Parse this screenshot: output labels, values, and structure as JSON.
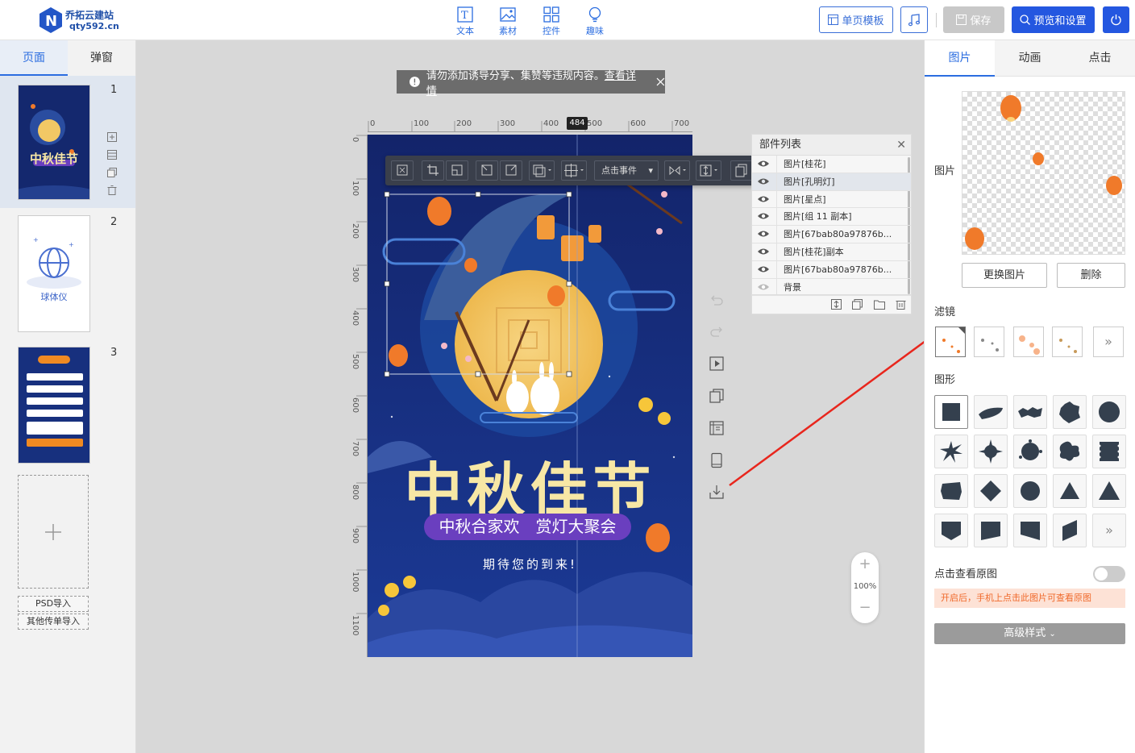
{
  "brand": {
    "name": "乔拓云建站",
    "domain": "qty592.cn"
  },
  "toolbar": {
    "tools": [
      {
        "label": "文本",
        "icon": "text-icon"
      },
      {
        "label": "素材",
        "icon": "image-icon"
      },
      {
        "label": "控件",
        "icon": "widgets-icon"
      },
      {
        "label": "趣味",
        "icon": "bulb-icon"
      }
    ],
    "template_button": "单页模板",
    "music_icon": "music-note-icon",
    "save_button": "保存",
    "preview_button": "预览和设置",
    "power_icon": "power-icon"
  },
  "left_panel": {
    "tabs": [
      "页面",
      "弹窗"
    ],
    "pages": [
      {
        "number": "1",
        "thumb_title": "中秋佳节"
      },
      {
        "number": "2",
        "thumb_title": "球体仪"
      },
      {
        "number": "3",
        "thumb_title": ""
      }
    ],
    "import_psd": "PSD导入",
    "import_other": "其他传单导入"
  },
  "workspace": {
    "notice_text": "请勿添加诱导分享、集赞等违规内容。",
    "notice_link": "查看详情",
    "ruler_h_ticks": [
      "0",
      "100",
      "200",
      "300",
      "400",
      "500",
      "600",
      "700"
    ],
    "ruler_v_ticks": [
      "0",
      "100",
      "200",
      "300",
      "400",
      "500",
      "600",
      "700",
      "800",
      "900",
      "1000",
      "1100"
    ],
    "ruler_badge": "484",
    "canvas": {
      "title": "中秋佳节",
      "subtitle_pill": "中秋合家欢　赏灯大聚会",
      "tagline": "期待您的到来!"
    },
    "float_toolbar": {
      "event_select": "点击事件"
    },
    "zoom": "100%"
  },
  "layers": {
    "title": "部件列表",
    "items": [
      "图片[桂花]",
      "图片[孔明灯]",
      "图片[星点]",
      "图片[组 11 副本]",
      "图片[67bab80a97876b...",
      "图片[桂花]副本",
      "图片[67bab80a97876b...",
      "背景"
    ]
  },
  "right_panel": {
    "tabs": [
      "图片",
      "动画",
      "点击"
    ],
    "image_label": "图片",
    "replace_button": "更换图片",
    "delete_button": "删除",
    "filter_label": "滤镜",
    "shape_label": "图形",
    "more_symbol": "»",
    "view_original_label": "点击查看原图",
    "view_original_hint": "开启后，手机上点击此图片可查看原图",
    "advanced_button": "高级样式"
  },
  "colors": {
    "accent": "#2b6de0",
    "primary_button": "#2457e0",
    "canvas_bg": "#14286e",
    "title_gold": "#f7e7a5",
    "pill_purple": "#6a3fbf",
    "arrow_red": "#e8261d"
  }
}
